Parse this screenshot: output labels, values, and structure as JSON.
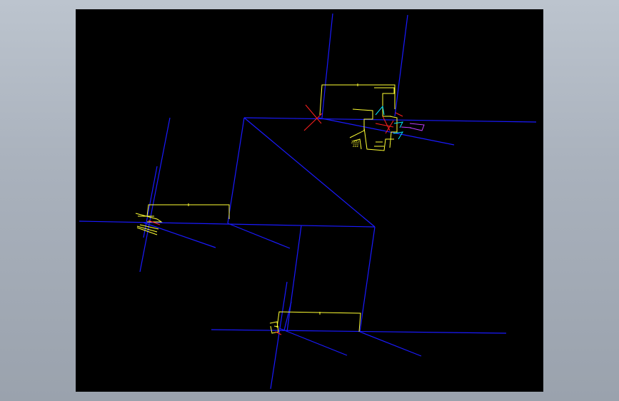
{
  "colors": {
    "background_outer": "#aab2bd",
    "viewport": "#000000",
    "pipe": "#1a1aff",
    "dimension": "#ffff33",
    "marker": "#ff2020",
    "annotation_cyan": "#00e5ff",
    "annotation_magenta": "#c040ff"
  },
  "drawing": {
    "type": "isometric-cad-pipe-diagram",
    "groups": [
      "top-right-joint",
      "left-joint",
      "bottom-joint"
    ]
  }
}
